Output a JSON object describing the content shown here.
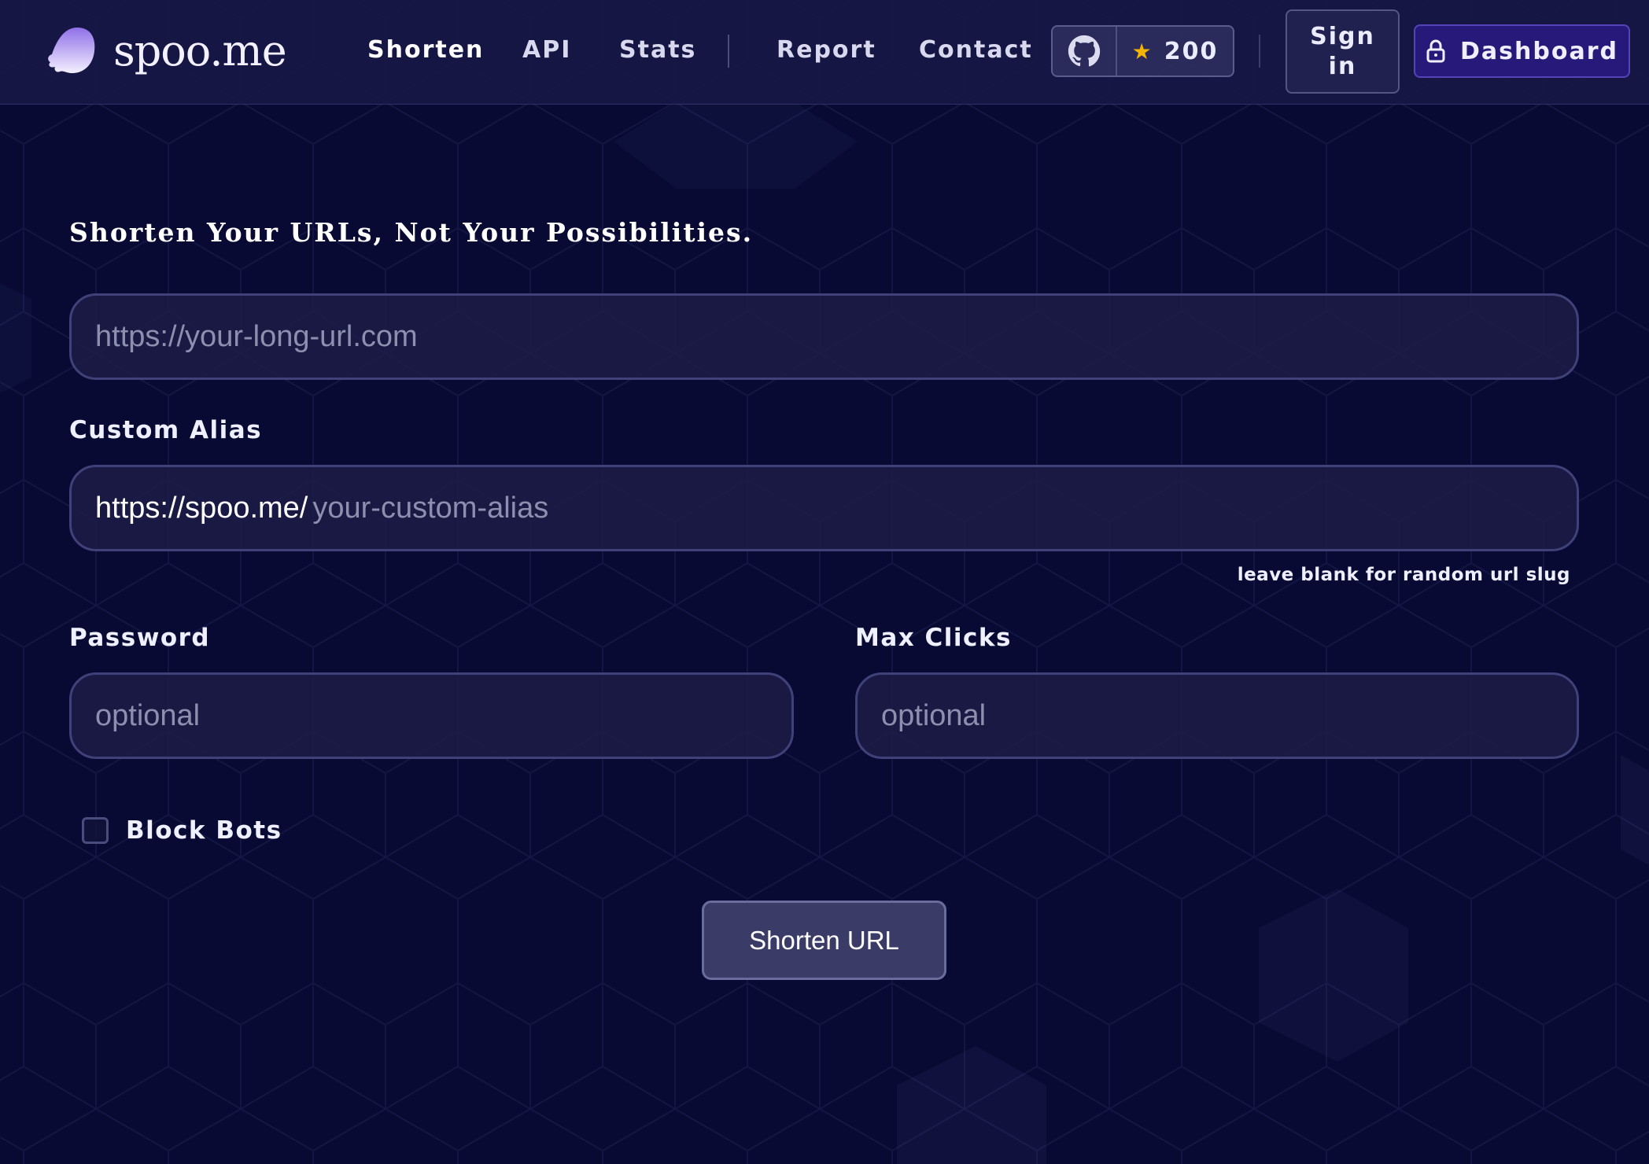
{
  "header": {
    "brand": "spoo.me",
    "nav": [
      {
        "label": "Shorten",
        "active": true
      },
      {
        "label": "API",
        "active": false
      },
      {
        "label": "Stats",
        "active": false
      },
      {
        "label": "Report",
        "active": false
      },
      {
        "label": "Contact",
        "active": false
      }
    ],
    "github_stars": "200",
    "signin_label": "Sign in",
    "dashboard_label": "Dashboard"
  },
  "form": {
    "headline": "Shorten Your URLs, Not Your Possibilities.",
    "long_url_placeholder": "https://your-long-url.com",
    "alias_label": "Custom Alias",
    "alias_prefix": "https://spoo.me/",
    "alias_placeholder": "your-custom-alias",
    "alias_hint": "leave blank for random url slug",
    "password_label": "Password",
    "password_placeholder": "optional",
    "max_clicks_label": "Max Clicks",
    "max_clicks_placeholder": "optional",
    "block_bots_label": "Block Bots",
    "block_bots_checked": false,
    "submit_label": "Shorten URL"
  },
  "icons": {
    "logo": "ghost-logo-icon",
    "github": "github-icon",
    "star": "star-icon",
    "lock": "lock-icon"
  },
  "colors": {
    "background": "#080a33",
    "header": "#18184a",
    "accent": "#26197a",
    "star": "#f4b400"
  }
}
